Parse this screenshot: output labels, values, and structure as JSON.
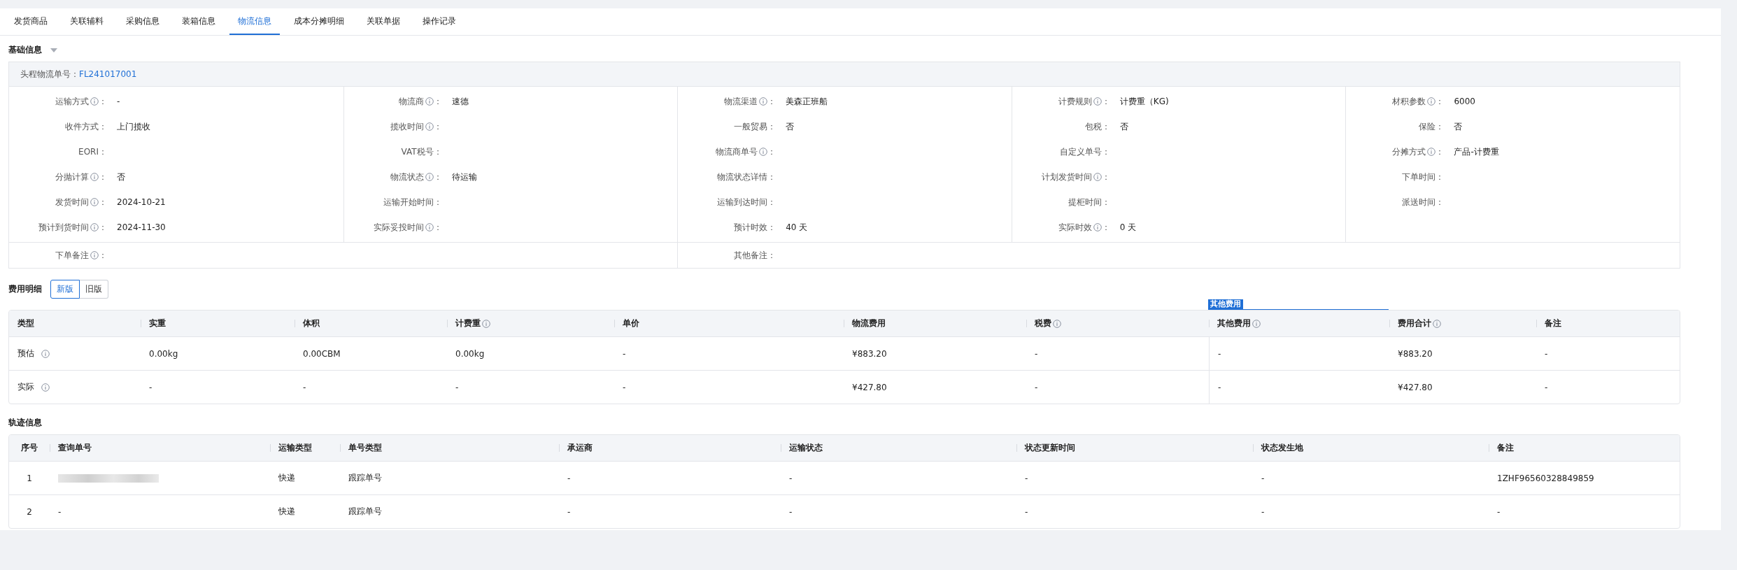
{
  "tabs": [
    {
      "label": "发货商品",
      "selected": false
    },
    {
      "label": "关联辅料",
      "selected": false
    },
    {
      "label": "采购信息",
      "selected": false
    },
    {
      "label": "装箱信息",
      "selected": false
    },
    {
      "label": "物流信息",
      "selected": true
    },
    {
      "label": "成本分摊明细",
      "selected": false
    },
    {
      "label": "关联单据",
      "selected": false
    },
    {
      "label": "操作记录",
      "selected": false
    }
  ],
  "basic_info": {
    "title": "基础信息",
    "expanded": true,
    "order_label": "头程物流单号：",
    "order_number": "FL241017001",
    "rows": [
      [
        {
          "label": "运输方式",
          "info": true,
          "colon": "：",
          "value": "-"
        },
        {
          "label": "物流商",
          "info": true,
          "colon": "：",
          "value": "速德"
        },
        {
          "label": "物流渠道",
          "info": true,
          "colon": "：",
          "value": "美森正班船"
        },
        {
          "label": "计费规则",
          "info": true,
          "colon": "：",
          "value": "计费重（KG)"
        },
        {
          "label": "材积参数",
          "info": true,
          "colon": "：",
          "value": "6000"
        }
      ],
      [
        {
          "label": "收件方式",
          "info": false,
          "colon": "：",
          "value": "上门揽收"
        },
        {
          "label": "揽收时间",
          "info": true,
          "colon": "："
        },
        {
          "label": "一般贸易",
          "info": false,
          "colon": "：",
          "value": "否"
        },
        {
          "label": "包税",
          "info": false,
          "colon": "：",
          "value": "否"
        },
        {
          "label": "保险",
          "info": false,
          "colon": "：",
          "value": "否"
        }
      ],
      [
        {
          "label": "EORI",
          "info": false,
          "colon": "："
        },
        {
          "label": "VAT税号",
          "info": false,
          "colon": "："
        },
        {
          "label": "物流商单号",
          "info": true,
          "colon": "："
        },
        {
          "label": "自定义单号",
          "info": false,
          "colon": "："
        },
        {
          "label": "分摊方式",
          "info": true,
          "colon": "：",
          "value": "产品-计费重"
        }
      ],
      [
        {
          "label": "分抛计算",
          "info": true,
          "colon": "：",
          "value": "否"
        },
        {
          "label": "物流状态",
          "info": true,
          "colon": "：",
          "value": "待运输"
        },
        {
          "label": "物流状态详情",
          "info": false,
          "colon": "："
        },
        {
          "label": "计划发货时间",
          "info": true,
          "colon": "："
        },
        {
          "label": "下单时间",
          "info": false,
          "colon": "："
        }
      ],
      [
        {
          "label": "发货时间",
          "info": true,
          "colon": "：",
          "value": "2024-10-21"
        },
        {
          "label": "运输开始时间",
          "info": false,
          "colon": "："
        },
        {
          "label": "运输到达时间",
          "info": false,
          "colon": "："
        },
        {
          "label": "提柜时间",
          "info": false,
          "colon": "："
        },
        {
          "label": "派送时间",
          "info": false,
          "colon": "："
        }
      ],
      [
        {
          "label": "预计到货时间",
          "info": true,
          "colon": "：",
          "value": "2024-11-30"
        },
        {
          "label": "实际妥投时间",
          "info": true,
          "colon": "："
        },
        {
          "label": "预计时效",
          "info": false,
          "colon": "：",
          "value": "40 天"
        },
        {
          "label": "实际时效",
          "info": true,
          "colon": "：",
          "value": "0 天"
        }
      ]
    ],
    "remarks": [
      {
        "label": "下单备注",
        "info": true,
        "colon": "："
      },
      {
        "label": "其他备注",
        "info": false,
        "colon": "："
      }
    ]
  },
  "fees": {
    "title": "费用明细",
    "versions": [
      {
        "label": "新版",
        "selected": true
      },
      {
        "label": "旧版",
        "selected": false
      }
    ],
    "group_label": "其他费用",
    "columns": [
      {
        "label": "类型",
        "info": false
      },
      {
        "label": "实重",
        "info": false
      },
      {
        "label": "体积",
        "info": false
      },
      {
        "label": "计费重",
        "info": true
      },
      {
        "label": "单价",
        "info": false
      },
      {
        "label": "物流费用",
        "info": false
      },
      {
        "label": "税费",
        "info": true
      },
      {
        "label": "其他费用",
        "info": true
      },
      {
        "label": "费用合计",
        "info": true
      },
      {
        "label": "备注",
        "info": false
      }
    ],
    "rows": [
      {
        "info": true,
        "cells": [
          "预估",
          "0.00kg",
          "0.00CBM",
          "0.00kg",
          "-",
          "¥883.20",
          "-",
          "-",
          "¥883.20",
          "-"
        ]
      },
      {
        "info": true,
        "cells": [
          "实际",
          "-",
          "-",
          "-",
          "-",
          "¥427.80",
          "-",
          "-",
          "¥427.80",
          "-"
        ]
      }
    ]
  },
  "tracking": {
    "title": "轨迹信息",
    "columns": [
      "序号",
      "查询单号",
      "运输类型",
      "单号类型",
      "承运商",
      "运输状态",
      "状态更新时间",
      "状态发生地",
      "备注"
    ],
    "rows": [
      {
        "query_redacted": true,
        "cells": [
          "1",
          "",
          "快递",
          "跟踪单号",
          "-",
          "-",
          "-",
          "-",
          "1ZHF96560328849859"
        ]
      },
      {
        "query_redacted": false,
        "cells": [
          "2",
          "-",
          "快递",
          "跟踪单号",
          "-",
          "-",
          "-",
          "-",
          "-"
        ]
      }
    ]
  }
}
